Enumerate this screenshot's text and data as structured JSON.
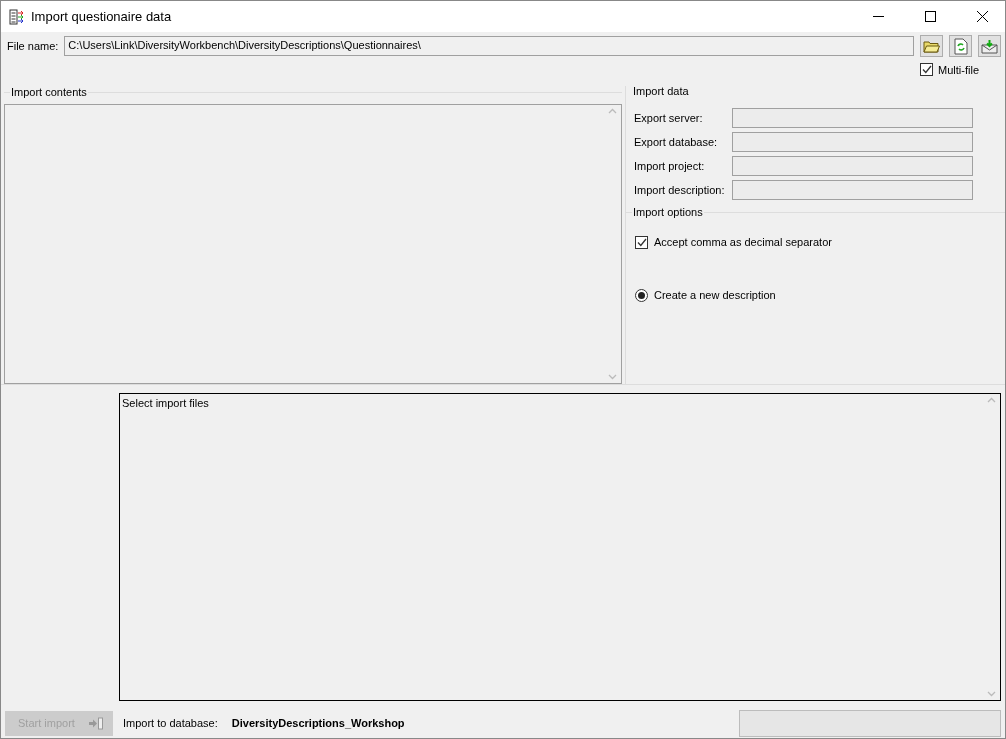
{
  "window": {
    "title": "Import questionaire data"
  },
  "file": {
    "label": "File name:",
    "value": "C:\\Users\\Link\\DiversityWorkbench\\DiversityDescriptions\\Questionnaires\\"
  },
  "multi_file": {
    "label": "Multi-file",
    "checked": true
  },
  "import_contents": {
    "title": "Import contents"
  },
  "import_data": {
    "title": "Import data",
    "fields": [
      {
        "label": "Export server:",
        "disabled": true
      },
      {
        "label": "Export database:",
        "disabled": true
      },
      {
        "label": "Import project:",
        "disabled": true
      },
      {
        "label": "Import description:",
        "disabled": true
      }
    ]
  },
  "import_options": {
    "title": "Import options",
    "options": [
      {
        "kind": "checkbox",
        "label": "Accept comma as decimal separator",
        "checked": true
      },
      {
        "kind": "radio",
        "label": "Create a new description",
        "selected": true
      }
    ]
  },
  "log": {
    "text": "Select import files"
  },
  "start_button": {
    "label": "Start import",
    "disabled": true
  },
  "target": {
    "label": "Import to database:",
    "value": "DiversityDescriptions_Workshop"
  }
}
